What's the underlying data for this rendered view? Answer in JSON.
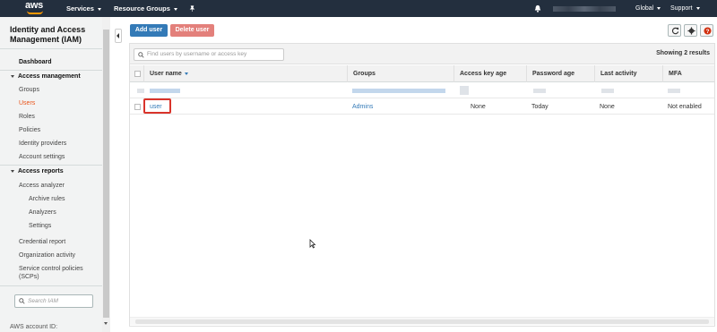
{
  "topnav": {
    "logo_text": "aws",
    "services": "Services",
    "resource_groups": "Resource Groups",
    "region": "Global",
    "support": "Support"
  },
  "sidebar": {
    "title": "Identity and Access Management (IAM)",
    "dashboard": "Dashboard",
    "access_management": {
      "label": "Access management",
      "items": [
        "Groups",
        "Users",
        "Roles",
        "Policies",
        "Identity providers",
        "Account settings"
      ],
      "active": "Users"
    },
    "access_reports": {
      "label": "Access reports",
      "items": [
        "Access analyzer"
      ],
      "sub_items": [
        "Archive rules",
        "Analyzers",
        "Settings"
      ],
      "more_items": [
        "Credential report",
        "Organization activity",
        "Service control policies (SCPs)"
      ]
    },
    "search_placeholder": "Search IAM",
    "footer": "AWS account ID:"
  },
  "toolbar": {
    "add_user": "Add user",
    "delete_user": "Delete user",
    "icons": [
      "refresh-icon",
      "gear-icon",
      "help-icon"
    ]
  },
  "table": {
    "filter_placeholder": "Find users by username or access key",
    "results_text": "Showing 2 results",
    "columns": [
      "User name",
      "Groups",
      "Access key age",
      "Password age",
      "Last activity",
      "MFA"
    ],
    "rows": [
      {
        "user_name": "user",
        "groups": "Admins",
        "access_key_age": "None",
        "password_age": "Today",
        "last_activity": "None",
        "mfa": "Not enabled"
      }
    ]
  },
  "colors": {
    "nav_bg": "#232f3e",
    "accent_orange": "#ff9900",
    "active_link": "#e9541a",
    "primary_button": "#337ab7",
    "danger_button": "#e3807b",
    "highlight": "#d9342b"
  }
}
